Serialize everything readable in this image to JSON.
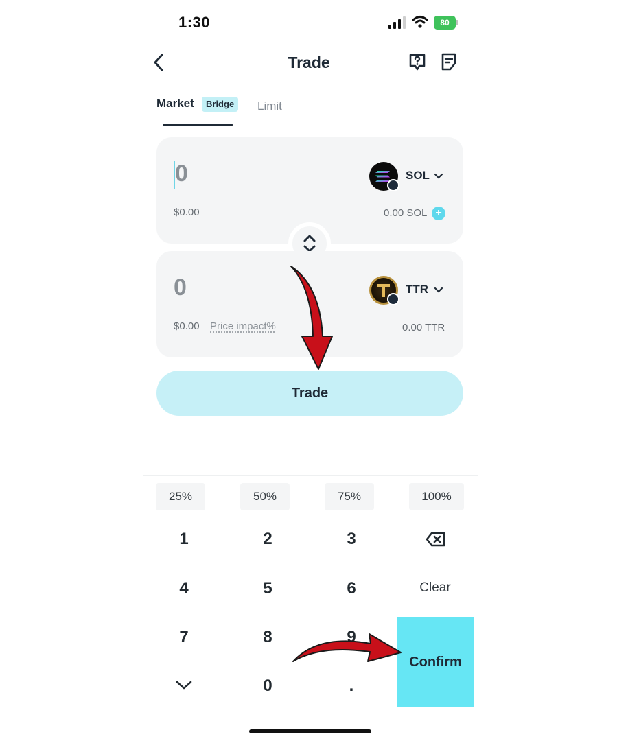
{
  "status_bar": {
    "time": "1:30",
    "battery": "80",
    "icons": [
      "signal-icon",
      "wifi-icon",
      "battery-icon"
    ]
  },
  "header": {
    "title": "Trade",
    "back_icon": "chevron-left-icon",
    "help_icon": "help-icon",
    "orders_icon": "orders-icon"
  },
  "tabs": {
    "market": "Market",
    "market_badge": "Bridge",
    "limit": "Limit"
  },
  "from": {
    "amount": "0",
    "usd": "$0.00",
    "token": "SOL",
    "balance": "0.00 SOL",
    "add_label": "+"
  },
  "to": {
    "amount": "0",
    "usd": "$0.00",
    "price_impact": "Price impact%",
    "token": "TTR",
    "balance": "0.00 TTR"
  },
  "trade_button": "Trade",
  "percent_chips": [
    "25%",
    "50%",
    "75%",
    "100%"
  ],
  "keypad": {
    "k1": "1",
    "k2": "2",
    "k3": "3",
    "k4": "4",
    "k5": "5",
    "k6": "6",
    "k7": "7",
    "k8": "8",
    "k9": "9",
    "k0": "0",
    "dot": ".",
    "clear": "Clear",
    "confirm": "Confirm"
  },
  "colors": {
    "accent": "#66e6f4",
    "trade_button": "#c6f0f7",
    "card": "#f4f5f6",
    "annotation_arrow": "#c8101a"
  }
}
